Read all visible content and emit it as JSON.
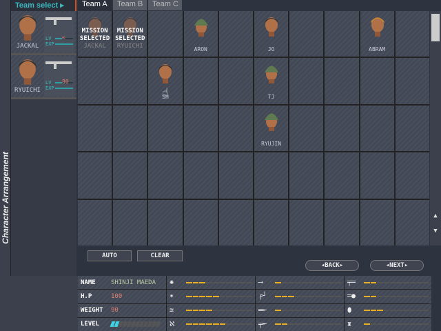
{
  "sidebar": {
    "title": "Character Arrangement"
  },
  "team_select": {
    "label": "Team select ▸"
  },
  "roster": [
    {
      "name": "JACKAL",
      "ammo": "∞",
      "lv_label": "LV",
      "exp_label": "EXP",
      "lv": 0.4,
      "exp": 1.0
    },
    {
      "name": "RYUICHI",
      "ammo": "80",
      "lv_label": "LV",
      "exp_label": "EXP",
      "lv": 0.4,
      "exp": 1.0
    }
  ],
  "tabs": [
    {
      "label": "Team A",
      "active": true
    },
    {
      "label": "Team B"
    },
    {
      "label": "Team C"
    }
  ],
  "grid": {
    "mission_text": "MISSION SELECTED",
    "cells": [
      {
        "row": 0,
        "col": 0,
        "name": "JACKAL",
        "mission": true
      },
      {
        "row": 0,
        "col": 1,
        "name": "RYUICHI",
        "mission": true
      },
      {
        "row": 0,
        "col": 3,
        "name": "ARON",
        "helmet": true
      },
      {
        "row": 0,
        "col": 5,
        "name": "JO"
      },
      {
        "row": 0,
        "col": 8,
        "name": "ABRAM",
        "blond": true
      },
      {
        "row": 1,
        "col": 2,
        "name": "SH",
        "cursor": true
      },
      {
        "row": 1,
        "col": 5,
        "name": "TJ",
        "helmet": true
      },
      {
        "row": 2,
        "col": 5,
        "name": "RYUJIN",
        "helmet": true
      }
    ]
  },
  "buttons": {
    "auto": "AUTO",
    "clear": "CLEAR",
    "back": "◂BACK▸",
    "next": "◂NEXT▸"
  },
  "stats": {
    "name_label": "NAME",
    "name": "SHINJI MAEDA",
    "hp_label": "H.P",
    "hp": "100",
    "weight_label": "WEIGHT",
    "weight": "90",
    "level_label": "LEVEL",
    "level": 2,
    "level_max": 12
  },
  "skills": [
    [
      {
        "icon": "armor-icon",
        "g": "✺",
        "v": 3
      },
      {
        "icon": "knife-icon",
        "g": "⟶",
        "v": 1
      },
      {
        "icon": "rifle-icon",
        "g": "╤═",
        "v": 2
      }
    ],
    [
      {
        "icon": "melee-icon",
        "g": "✶",
        "v": 5
      },
      {
        "icon": "smg-icon",
        "g": "╒┘",
        "v": 3
      },
      {
        "icon": "rocket-icon",
        "g": "═●",
        "v": 2
      }
    ],
    [
      {
        "icon": "dodge-icon",
        "g": "≋",
        "v": 4
      },
      {
        "icon": "shotgun-icon",
        "g": "═╾",
        "v": 1
      },
      {
        "icon": "grenade-icon",
        "g": "⬮",
        "v": 3
      }
    ],
    [
      {
        "icon": "walk-icon",
        "g": "ℵ",
        "v": 6
      },
      {
        "icon": "sniper-icon",
        "g": "╤╾",
        "v": 2
      },
      {
        "icon": "bomb-icon",
        "g": "♜",
        "v": 1
      }
    ]
  ],
  "colors": {
    "accent": "#3bb8c0",
    "skill": "#e8b020",
    "number": "#e08070"
  }
}
